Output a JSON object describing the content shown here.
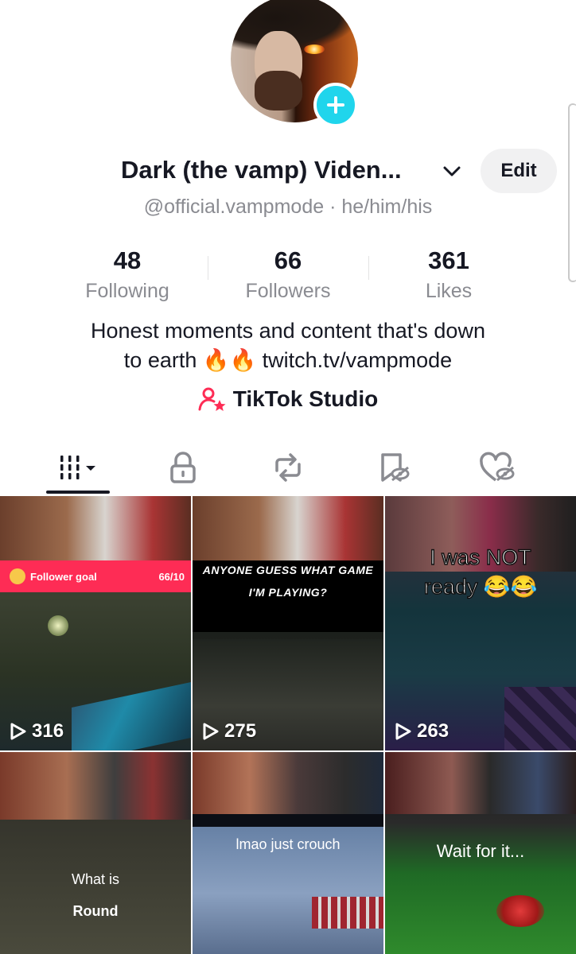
{
  "profile": {
    "display_name": "Dark (the vamp) Viden...",
    "handle_line": "@official.vampmode · he/him/his",
    "edit_label": "Edit",
    "bio_line1": "Honest moments and content that's down",
    "bio_line2": "to earth 🔥🔥 twitch.tv/vampmode",
    "studio_label": "TikTok Studio"
  },
  "stats": [
    {
      "value": "48",
      "label": "Following"
    },
    {
      "value": "66",
      "label": "Followers"
    },
    {
      "value": "361",
      "label": "Likes"
    }
  ],
  "tabs": [
    {
      "icon": "grid-icon",
      "active": true
    },
    {
      "icon": "lock-icon"
    },
    {
      "icon": "repost-icon"
    },
    {
      "icon": "bookmark-icon"
    },
    {
      "icon": "heart-icon"
    }
  ],
  "videos": [
    {
      "views": "316",
      "banner_label": "Follower goal",
      "banner_count": "66/10"
    },
    {
      "views": "275",
      "caption_line1": "ANYONE GUESS WHAT GAME",
      "caption_line2": "I'M PLAYING?"
    },
    {
      "views": "263",
      "caption_line1": "I was NOT",
      "caption_line2": "ready 😂😂"
    },
    {
      "caption_line1": "What is",
      "caption_line2": "Round"
    },
    {
      "caption_line1": "lmao just crouch"
    },
    {
      "caption_line1": "Wait for it..."
    }
  ],
  "colors": {
    "accent_cyan": "#20d5ec",
    "studio_pink": "#fe2c55",
    "goal_banner": "#fe2c55"
  }
}
